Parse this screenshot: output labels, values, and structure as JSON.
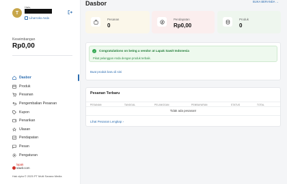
{
  "sidebar": {
    "avatar_letter": "T",
    "greeting": "Halo,",
    "view_shop": "Lihat toko Anda",
    "balance_label": "Keseimbangan",
    "balance_value": "Rp0,00",
    "nav": [
      {
        "label": "Dasbor",
        "icon": "home-icon",
        "active": true
      },
      {
        "label": "Produk",
        "icon": "box-icon"
      },
      {
        "label": "Pesanan",
        "icon": "cart-icon"
      },
      {
        "label": "Pengembalian Pesanan",
        "icon": "return-icon"
      },
      {
        "label": "Kupon",
        "icon": "tag-icon"
      },
      {
        "label": "Penarikan",
        "icon": "wallet-icon"
      },
      {
        "label": "Ulasan",
        "icon": "star-icon"
      },
      {
        "label": "Pendapatan",
        "icon": "chart-icon"
      },
      {
        "label": "Pesan",
        "icon": "message-icon"
      },
      {
        "label": "Pengaturan",
        "icon": "gear-icon"
      }
    ],
    "logo_line1": "lapak",
    "logo_line2": "sawit.com",
    "copyright": "Hak cipta © 2025 PT Multi Sarana Media"
  },
  "header": {
    "title": "Dasbor",
    "open_shop": "BUKA BERANDA →"
  },
  "stats": [
    {
      "label": "Pesanan",
      "value": "0",
      "bg": "#fbf7ea",
      "icon_bg": "#ffffff",
      "icon": "bag-icon"
    },
    {
      "label": "Pendapatan",
      "value": "Rp0,00",
      "bg": "#fbeeee",
      "icon_bg": "#ffffff",
      "icon": "money-icon"
    },
    {
      "label": "Produk",
      "value": "0",
      "bg": "#eef6ee",
      "icon_bg": "#ffffff",
      "icon": "product-icon"
    }
  ],
  "alert": {
    "title": "Congratulations on being a vendor at Lapak Sawit Indonesia",
    "body": "Pikat pelanggan Anda dengan produk terbaik."
  },
  "add_product_link": "Buat produk baru di sini",
  "recent_orders": {
    "title": "Pesanan Terbaru",
    "columns": [
      "PESANAN",
      "TANGGAL",
      "PELANGGAN",
      "PEMBAYARAN",
      "STATUS",
      "TOTAL"
    ],
    "empty_text": "Tidak ada pesanan!",
    "view_all": "Lihat Pesanan Lengkap  ›"
  },
  "colors": {
    "accent": "#2b6cb0",
    "success": "#34a853",
    "brand": "#d0322a"
  }
}
